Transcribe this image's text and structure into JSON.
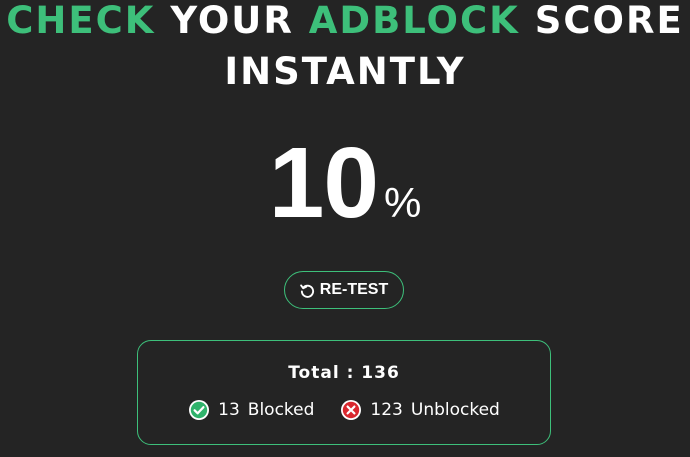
{
  "headline": {
    "line1": [
      {
        "text": "CHECK",
        "accent": true
      },
      {
        "text": "YOUR",
        "accent": false
      },
      {
        "text": "ADBLOCK",
        "accent": true
      },
      {
        "text": "SCORE",
        "accent": false
      }
    ],
    "line2": "INSTANTLY"
  },
  "score": {
    "value": "10",
    "unit": "%"
  },
  "retest": {
    "icon": "refresh-icon",
    "label": "RE-TEST"
  },
  "summary": {
    "total_label": "Total",
    "total_value": "136",
    "blocked": {
      "icon": "check-circle-icon",
      "count": "13",
      "label": "Blocked"
    },
    "unblocked": {
      "icon": "x-circle-icon",
      "count": "123",
      "label": "Unblocked"
    }
  },
  "colors": {
    "background": "#242424",
    "accent": "#3dbf7a",
    "text": "#ffffff",
    "blocked_icon": "#2fb36b",
    "unblocked_icon": "#d9272e"
  }
}
